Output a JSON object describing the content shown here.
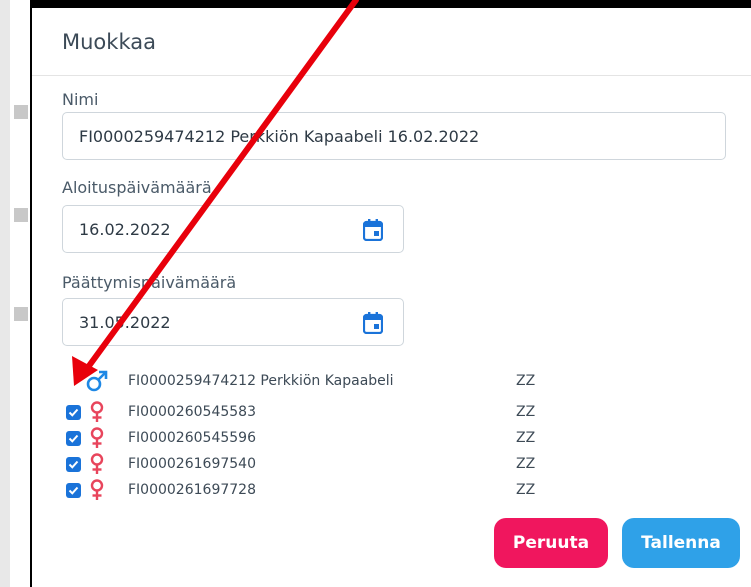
{
  "dialog": {
    "title": "Muokkaa",
    "name_label": "Nimi",
    "name_value": "FI0000259474212 Perkkiön Kapaabeli 16.02.2022",
    "start_label": "Aloituspäivämäärä",
    "start_value": "16.02.2022",
    "end_label": "Päättymispäivämäärä",
    "end_value": "31.05.2022",
    "cancel_label": "Peruuta",
    "save_label": "Tallenna"
  },
  "animals": [
    {
      "sex": "male",
      "name": "FI0000259474212 Perkkiön Kapaabeli",
      "code": "ZZ",
      "checked": false
    },
    {
      "sex": "female",
      "name": "FI0000260545583",
      "code": "ZZ",
      "checked": true
    },
    {
      "sex": "female",
      "name": "FI0000260545596",
      "code": "ZZ",
      "checked": true
    },
    {
      "sex": "female",
      "name": "FI0000261697540",
      "code": "ZZ",
      "checked": true
    },
    {
      "sex": "female",
      "name": "FI0000261697728",
      "code": "ZZ",
      "checked": true
    }
  ],
  "icons": {
    "calendar": "calendar-icon",
    "male": "male-symbol-icon",
    "female": "female-symbol-icon",
    "check": "checkmark-icon"
  },
  "colors": {
    "accent": "#1a73d9",
    "male": "#1e88e5",
    "female": "#e8455c",
    "cancel": "#f0165e",
    "save": "#2fa1e8",
    "arrow": "#e8000b"
  }
}
